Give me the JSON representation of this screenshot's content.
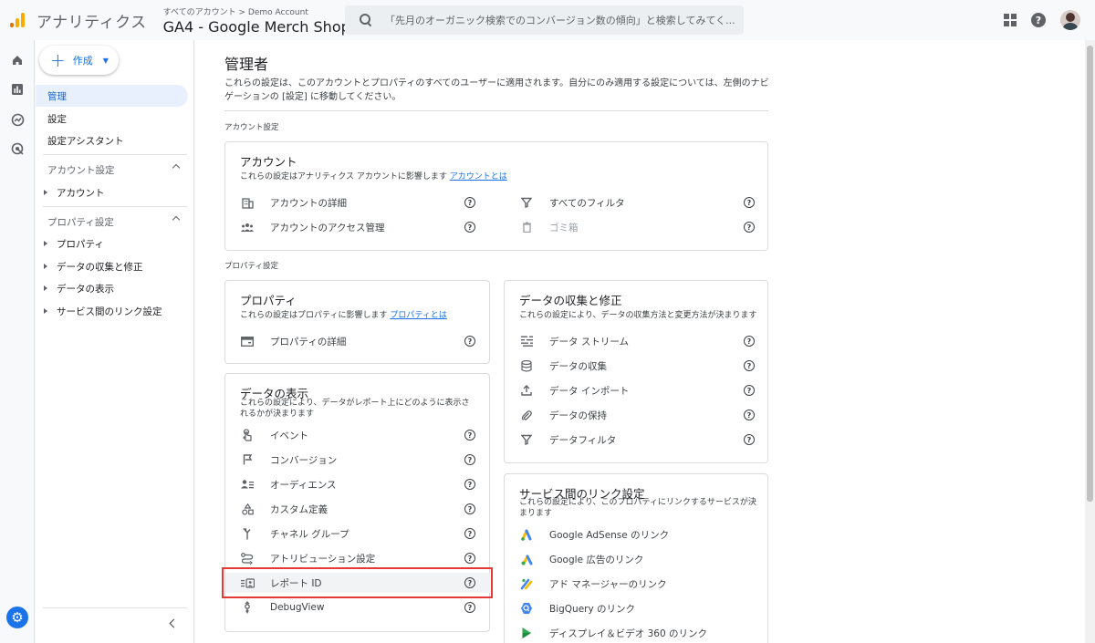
{
  "header": {
    "product": "アナリティクス",
    "breadcrumb": "すべてのアカウント > Demo Account",
    "property": "GA4 - Google Merch Shop",
    "search_placeholder": "「先月のオーガニック検索でのコンバージョン数の傾向」と検索してみてく..."
  },
  "sidebar": {
    "create_label": "作成",
    "items": [
      {
        "label": "管理",
        "active": true
      },
      {
        "label": "設定"
      },
      {
        "label": "設定アシスタント"
      }
    ],
    "account_section": "アカウント設定",
    "account_items": [
      "アカウント"
    ],
    "property_section": "プロパティ設定",
    "property_items": [
      "プロパティ",
      "データの収集と修正",
      "データの表示",
      "サービス間のリンク設定"
    ]
  },
  "main": {
    "title": "管理者",
    "description": "これらの設定は、このアカウントとプロパティのすべてのユーザーに適用されます。自分にのみ適用する設定については、左側のナビゲーションの [設定] に移動してください。",
    "account_label": "アカウント設定",
    "property_label": "プロパティ設定",
    "account_card": {
      "title": "アカウント",
      "sub": "これらの設定はアナリティクス アカウントに影響します",
      "link": "アカウントとは",
      "left": [
        "アカウントの詳細",
        "アカウントのアクセス管理"
      ],
      "right": [
        "すべてのフィルタ",
        "ゴミ箱"
      ]
    },
    "property_card": {
      "title": "プロパティ",
      "sub": "これらの設定はプロパティに影響します",
      "link": "プロパティとは",
      "items": [
        "プロパティの詳細"
      ]
    },
    "collection_card": {
      "title": "データの収集と修正",
      "sub": "これらの設定により、データの収集方法と変更方法が決まります",
      "items": [
        "データ ストリーム",
        "データの収集",
        "データ インポート",
        "データの保持",
        "データフィルタ"
      ]
    },
    "display_card": {
      "title": "データの表示",
      "sub": "これらの設定により、データがレポート上にどのように表示されるかが決まります",
      "items": [
        "イベント",
        "コンバージョン",
        "オーディエンス",
        "カスタム定義",
        "チャネル グループ",
        "アトリビューション設定",
        "レポート ID",
        "DebugView"
      ]
    },
    "links_card": {
      "title": "サービス間のリンク設定",
      "sub": "これらの設定により、このプロパティにリンクするサービスが決まります",
      "items": [
        "Google AdSense のリンク",
        "Google 広告のリンク",
        "アド マネージャーのリンク",
        "BigQuery のリンク",
        "ディスプレイ＆ビデオ 360 のリンク"
      ]
    }
  },
  "colors": {
    "accent": "#1a73e8",
    "highlight": "#e53935",
    "active_bg": "#e8f0fe"
  }
}
